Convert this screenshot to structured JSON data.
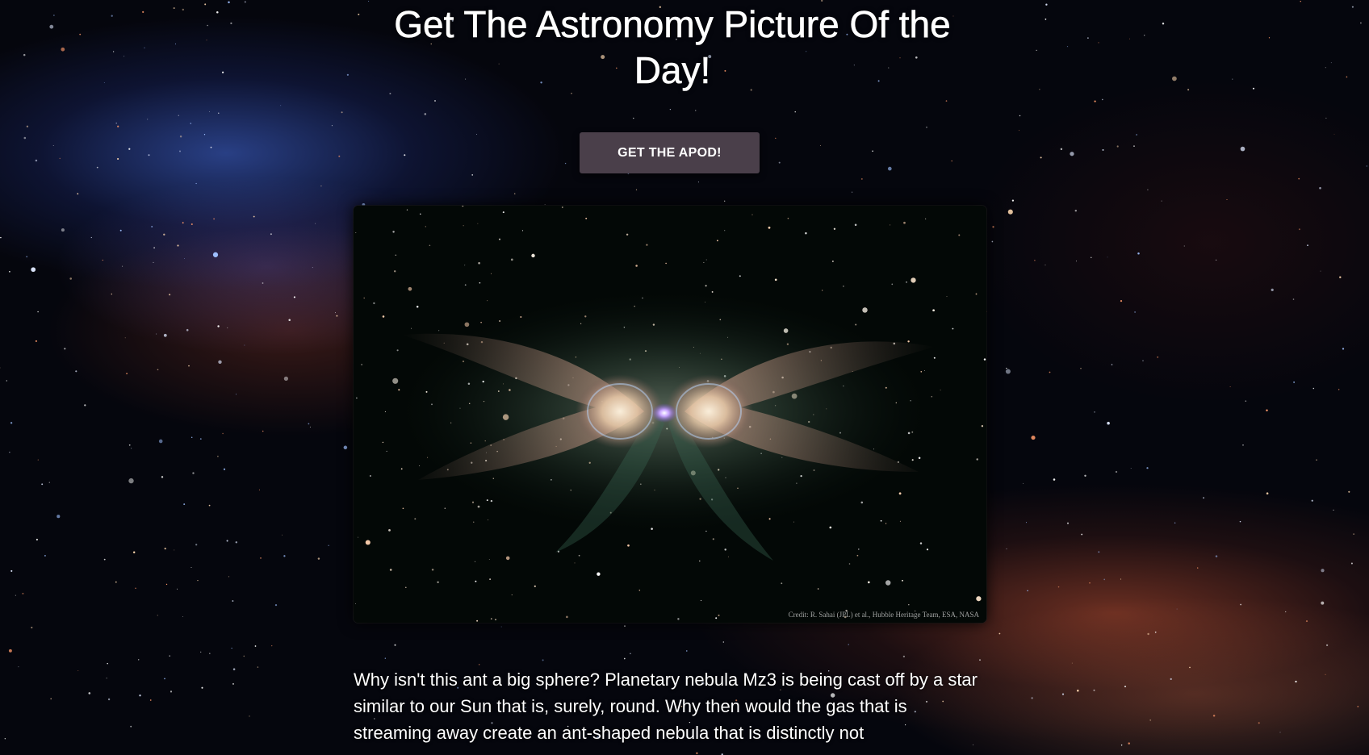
{
  "page": {
    "title": "Get The Astronomy Picture Of the Day!",
    "button_label": "GET THE APOD!"
  },
  "apod": {
    "image_subject": "Ant Nebula (planetary nebula Mz3)",
    "credit": "Credit: R. Sahai (JPL) et al., Hubble Heritage Team, ESA, NASA",
    "explanation": "Why isn't this ant a big sphere? Planetary nebula Mz3 is being cast off by a star similar to our Sun that is, surely, round. Why then would the gas that is streaming away create an ant-shaped nebula that is distinctly not"
  },
  "colors": {
    "button_bg": "#4a3f4a",
    "text": "#ffffff",
    "background": "#05060d"
  }
}
